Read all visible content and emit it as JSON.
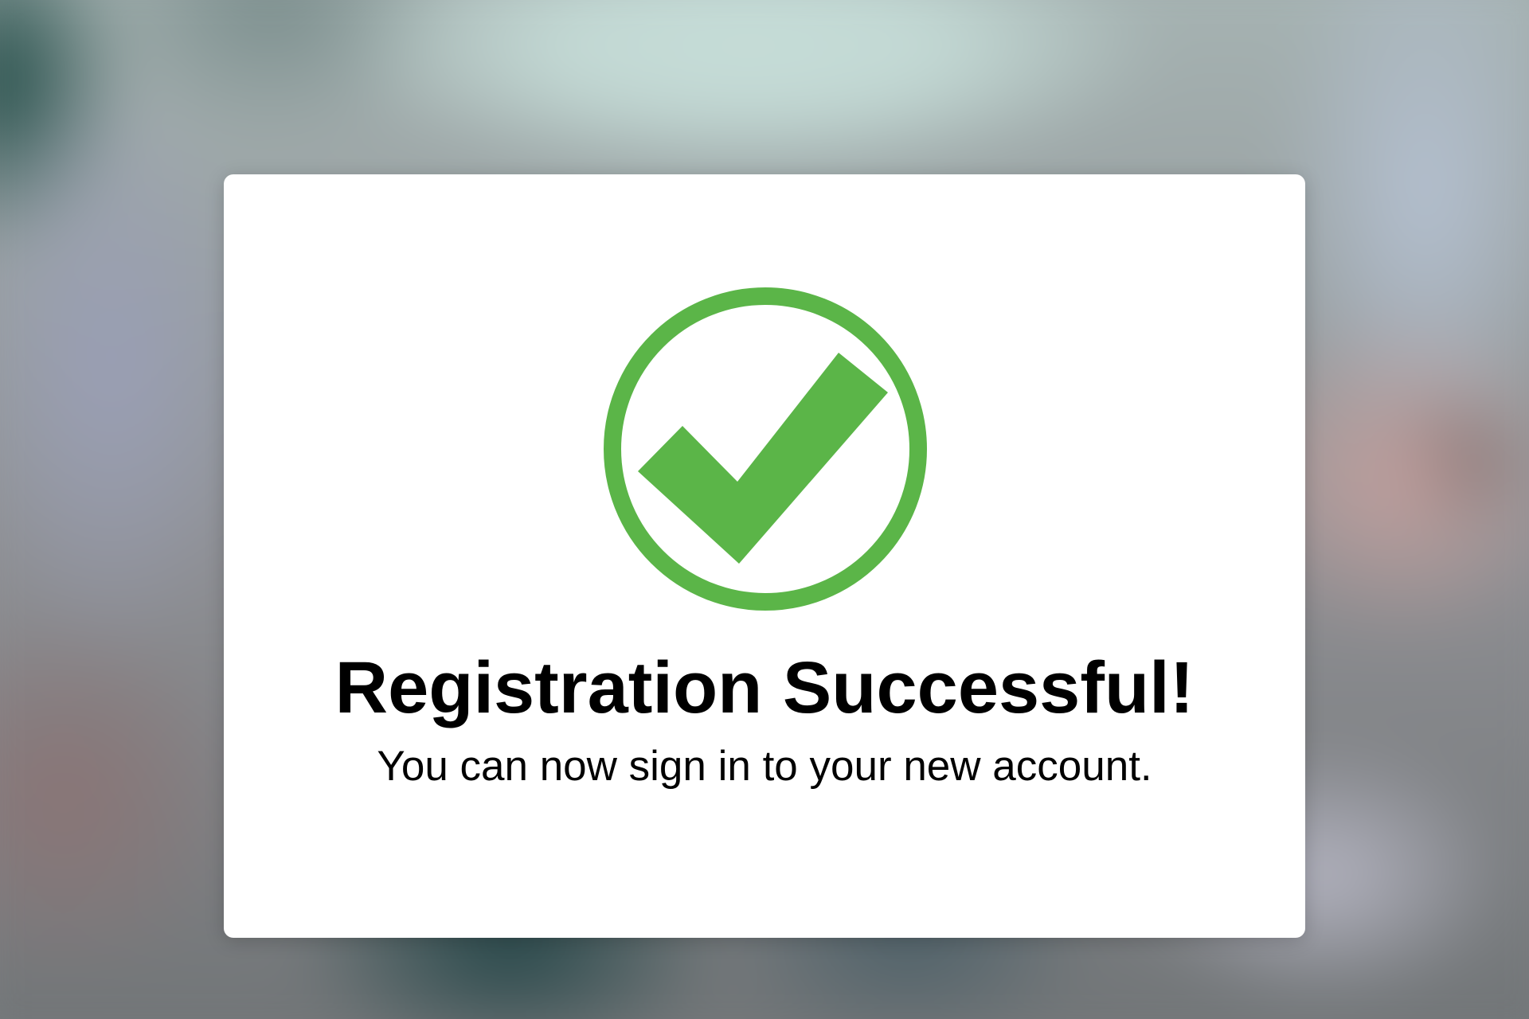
{
  "dialog": {
    "title": "Registration Successful!",
    "message": "You can now sign in to your new account.",
    "icon": "check-circle-icon"
  },
  "colors": {
    "success_green": "#5bb548",
    "card_background": "#ffffff",
    "text": "#000000"
  }
}
